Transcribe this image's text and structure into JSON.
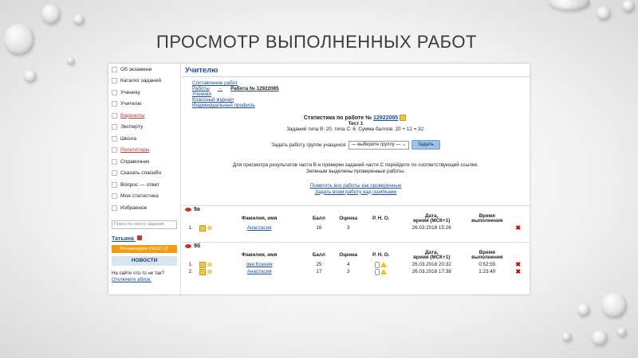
{
  "slide": {
    "title": "ПРОСМОТР ВЫПОЛНЕННЫХ РАБОТ"
  },
  "sidebar": {
    "items": [
      {
        "label": "Об экзамене",
        "red": false
      },
      {
        "label": "Каталог заданий",
        "red": false
      },
      {
        "label": "Ученику",
        "red": false
      },
      {
        "label": "Учителю",
        "red": false
      },
      {
        "label": "Варианты",
        "red": true
      },
      {
        "label": "Эксперту",
        "red": false
      },
      {
        "label": "Школа",
        "red": false
      },
      {
        "label": "Репетиторы",
        "red": true
      },
      {
        "label": "Справочник",
        "red": false
      },
      {
        "label": "Сказать спасибо",
        "red": false
      },
      {
        "label": "Вопрос — ответ",
        "red": false
      },
      {
        "label": "Моя статистика",
        "red": false
      },
      {
        "label": "Избранное",
        "red": false
      }
    ],
    "search_placeholder": "Поиск по тексту задания",
    "user": "Татьяна",
    "banner": "Рекомендуем РЕШУ ЦТ",
    "news": "НОВОСТИ",
    "note_text": "На сайте что-то не так?",
    "note_link": "Отключите аблок."
  },
  "main": {
    "header": "Учителю",
    "nav": {
      "compose": "Составление работ",
      "works": "Работы",
      "arrow": "→",
      "work_no": "Работа № 12922085",
      "students": "Ученики",
      "journal": "Классный журнал",
      "profile": "Индивидуальный профиль"
    },
    "stat": {
      "title_prefix": "Статистика по работе №",
      "number": "12922085",
      "test": "Тест 1",
      "summary": "Заданий типа B: 20, типа C: 6. Сумма баллов: 20 + 12 = 32."
    },
    "assign": {
      "label": "Задать работу группе учащихся",
      "select": "— выберите группу —",
      "button": "Задать"
    },
    "info": [
      "Для просмотра результатов части B и проверки заданий части C перейдите по соответствующей ссылке.",
      "Зеленым выделены проверенные работы."
    ],
    "links": {
      "mark_all": "Пометить все работы как проверенные",
      "assign_errors": "Задать всем работу над ошибками"
    },
    "columns": {
      "name": "Фамилия, имя",
      "score": "Балл",
      "grade": "Оценка",
      "rno": "Р. Н. О.",
      "date_1": "Дата,",
      "date_2": "время (МСК+1)",
      "time_1": "Время",
      "time_2": "выполнения"
    },
    "groups": [
      {
        "name": "9a",
        "rows": [
          {
            "n": "1.",
            "name": "Анастасия",
            "score": "16",
            "grade": "3",
            "date": "26.03.2018 15:26",
            "time": "",
            "warn": false
          }
        ]
      },
      {
        "name": "9б",
        "rows": [
          {
            "n": "1.",
            "name": "ова Ксения",
            "score": "25",
            "grade": "4",
            "date": "26.03.2018 20:32",
            "time": "0:52:55",
            "warn": true
          },
          {
            "n": "2.",
            "name": "Анастасия",
            "score": "17",
            "grade": "3",
            "date": "26.03.2018 17:38",
            "time": "1:23:40",
            "warn": true
          }
        ]
      }
    ]
  }
}
